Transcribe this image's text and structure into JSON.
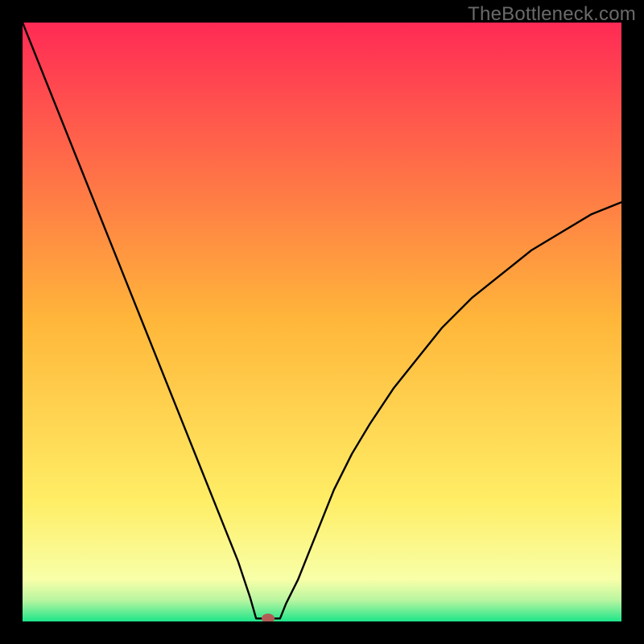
{
  "watermark": "TheBottleneck.com",
  "chart_data": {
    "type": "line",
    "title": "",
    "xlabel": "",
    "ylabel": "",
    "xlim": [
      0,
      100
    ],
    "ylim": [
      0,
      100
    ],
    "x": [
      0,
      2,
      4,
      6,
      8,
      10,
      12,
      14,
      16,
      18,
      20,
      22,
      24,
      26,
      28,
      30,
      32,
      34,
      36,
      38,
      39,
      40,
      41,
      42,
      43,
      44,
      46,
      48,
      50,
      52,
      55,
      58,
      62,
      66,
      70,
      75,
      80,
      85,
      90,
      95,
      100
    ],
    "values": [
      100,
      95,
      90,
      85,
      80,
      75,
      70,
      65,
      60,
      55,
      50,
      45,
      40,
      35,
      30,
      25,
      20,
      15,
      10,
      4,
      0.5,
      0.5,
      0.5,
      0.5,
      0.5,
      3,
      7,
      12,
      17,
      22,
      28,
      33,
      39,
      44,
      49,
      54,
      58,
      62,
      65,
      68,
      70
    ],
    "marker": {
      "x": 41,
      "y": 0.5,
      "color": "#b35c55"
    },
    "background_gradient": {
      "stops": [
        {
          "offset": 0.0,
          "color": "#ff2a55"
        },
        {
          "offset": 0.5,
          "color": "#ffb73a"
        },
        {
          "offset": 0.8,
          "color": "#ffee66"
        },
        {
          "offset": 0.93,
          "color": "#f8ffa8"
        },
        {
          "offset": 0.965,
          "color": "#b8f5a0"
        },
        {
          "offset": 1.0,
          "color": "#1de58a"
        }
      ]
    },
    "curve_color": "#000000",
    "curve_width": 2.4
  }
}
